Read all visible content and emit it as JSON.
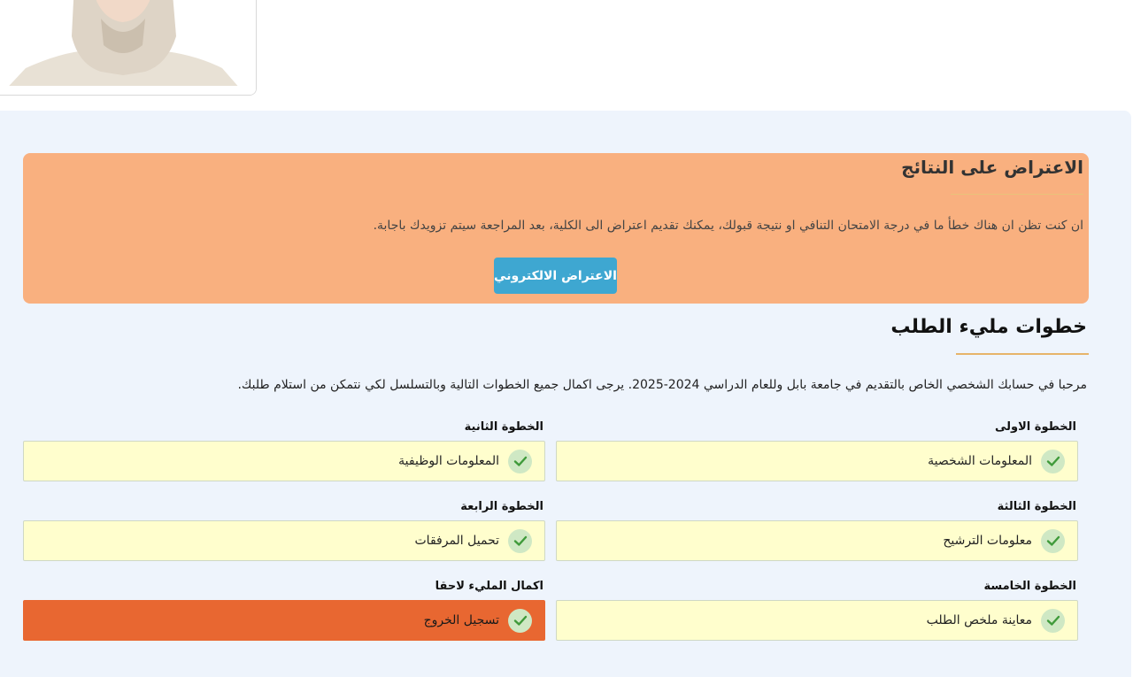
{
  "objection": {
    "title": "الاعتراض على النتائج",
    "text": "ان كنت تظن ان هناك خطأ ما في درجة الامتحان التنافي او نتيجة قبولك، يمكنك تقديم اعتراض الى الكلية، بعد المراجعة سيتم تزويدك باجابة.",
    "button_label": "الاعتراض الالكتروني"
  },
  "steps_section": {
    "title": "خطوات مليء الطلب",
    "welcome": "مرحبا في حسابك الشخصي الخاص بالتقديم في جامعة بابل وللعام الدراسي 2024-2025. يرجى اكمال جميع الخطوات التالية وبالتسلسل لكي نتمكن من استلام طلبك."
  },
  "steps": [
    {
      "label": "الخطوة الاولى",
      "text": "المعلومات الشخصية",
      "completed": true
    },
    {
      "label": "الخطوة الثانية",
      "text": "المعلومات الوظيفية",
      "completed": true
    },
    {
      "label": "الخطوة الثالثة",
      "text": "معلومات الترشيح",
      "completed": true
    },
    {
      "label": "الخطوة الرابعة",
      "text": "تحميل المرفقات",
      "completed": true
    },
    {
      "label": "الخطوة الخامسة",
      "text": "معاينة ملخص الطلب",
      "completed": true
    },
    {
      "label": "اكمال المليء لاحقا",
      "text": "تسجيل الخروج",
      "completed": true
    }
  ],
  "colors": {
    "objection_bg": "#f9b07f",
    "button_bg": "#3ea7d1",
    "step_bg": "#fffecd",
    "exit_bg": "#e86731",
    "check_green": "#3f9a3a",
    "panel_bg": "#eef4fc"
  },
  "icons": {
    "check": "check-icon",
    "photo": "profile-photo"
  }
}
